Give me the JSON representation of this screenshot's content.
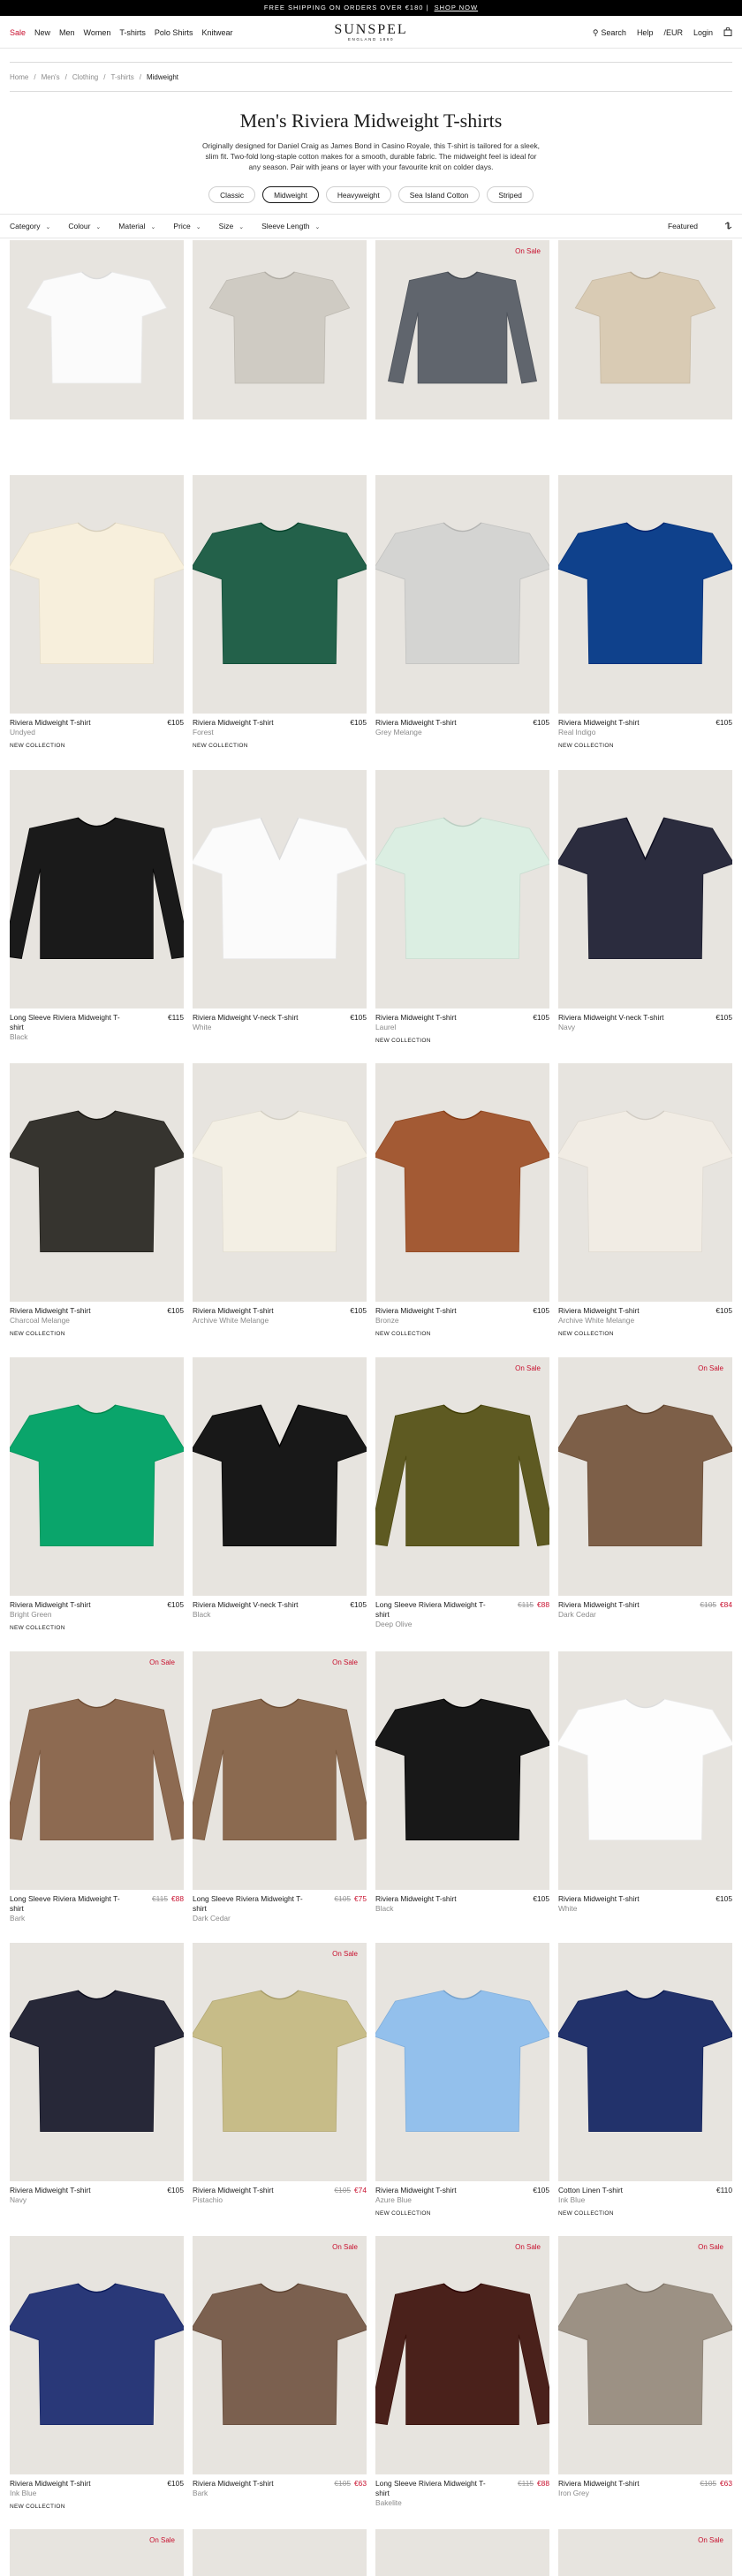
{
  "promo": {
    "text": "FREE SHIPPING ON ORDERS OVER €180",
    "link": "SHOP NOW"
  },
  "nav": {
    "left": [
      "Sale",
      "New",
      "Men",
      "Women",
      "T-shirts",
      "Polo Shirts",
      "Knitwear"
    ],
    "logo": "SUNSPEL",
    "logo_sub": "ENGLAND 1860",
    "search": "Search",
    "help": "Help",
    "currency": "/EUR",
    "login": "Login"
  },
  "breadcrumb": [
    "Home",
    "Men's",
    "Clothing",
    "T-shirts",
    "Midweight"
  ],
  "hero": {
    "title": "Men's Riviera Midweight T-shirts",
    "description": "Originally designed for Daniel Craig as James Bond in Casino Royale, this T-shirt is tailored for a sleek, slim fit. Two-fold long-staple cotton makes for a smooth, durable fabric. The midweight feel is ideal for any season. Pair with jeans or layer with your favourite knit on colder days."
  },
  "chips": [
    "Classic",
    "Midweight",
    "Heavyweight",
    "Sea Island Cotton",
    "Striped"
  ],
  "chips_active": "Midweight",
  "filters": [
    "Category",
    "Colour",
    "Material",
    "Price",
    "Size",
    "Sleeve Length"
  ],
  "sort": {
    "label": "Featured",
    "view_icon": "grid-view-icon"
  },
  "colors": {
    "sale": "#c8102e",
    "image_bg": "#e7e4df"
  },
  "products": [
    {
      "name": "",
      "color": "",
      "price": "",
      "orig_price": "",
      "badge": "",
      "tag": "",
      "shirt_color": "#fbfbfb",
      "type": "tee"
    },
    {
      "name": "",
      "color": "",
      "price": "",
      "orig_price": "",
      "badge": "",
      "tag": "",
      "shirt_color": "#cfcbc3",
      "type": "tee"
    },
    {
      "name": "",
      "color": "",
      "price": "",
      "orig_price": "",
      "badge": "On Sale",
      "tag": "",
      "shirt_color": "#60656d",
      "type": "long"
    },
    {
      "name": "",
      "color": "",
      "price": "",
      "orig_price": "",
      "badge": "",
      "tag": "",
      "shirt_color": "#d9cbb4",
      "type": "tee"
    },
    {
      "name": "Riviera Midweight T-shirt",
      "color": "Undyed",
      "price": "€105",
      "orig_price": "",
      "badge": "",
      "tag": "NEW COLLECTION",
      "shirt_color": "#f7efdc",
      "type": "tee"
    },
    {
      "name": "Riviera Midweight T-shirt",
      "color": "Forest",
      "price": "€105",
      "orig_price": "",
      "badge": "",
      "tag": "NEW COLLECTION",
      "shirt_color": "#23614a",
      "type": "tee"
    },
    {
      "name": "Riviera Midweight T-shirt",
      "color": "Grey Melange",
      "price": "€105",
      "orig_price": "",
      "badge": "",
      "tag": "",
      "shirt_color": "#d4d4d2",
      "type": "tee"
    },
    {
      "name": "Riviera Midweight T-shirt",
      "color": "Real Indigo",
      "price": "€105",
      "orig_price": "",
      "badge": "",
      "tag": "NEW COLLECTION",
      "shirt_color": "#0f418c",
      "type": "tee"
    },
    {
      "name": "Long Sleeve Riviera Midweight T-shirt",
      "color": "Black",
      "price": "€115",
      "orig_price": "",
      "badge": "",
      "tag": "",
      "shirt_color": "#1a1a1a",
      "type": "long"
    },
    {
      "name": "Riviera Midweight V-neck T-shirt",
      "color": "White",
      "price": "€105",
      "orig_price": "",
      "badge": "",
      "tag": "",
      "shirt_color": "#fbfbfb",
      "type": "vneck"
    },
    {
      "name": "Riviera Midweight T-shirt",
      "color": "Laurel",
      "price": "€105",
      "orig_price": "",
      "badge": "",
      "tag": "NEW COLLECTION",
      "shirt_color": "#dbeee2",
      "type": "tee"
    },
    {
      "name": "Riviera Midweight V-neck T-shirt",
      "color": "Navy",
      "price": "€105",
      "orig_price": "",
      "badge": "",
      "tag": "",
      "shirt_color": "#2b2c3e",
      "type": "vneck"
    },
    {
      "name": "Riviera Midweight T-shirt",
      "color": "Charcoal Melange",
      "price": "€105",
      "orig_price": "",
      "badge": "",
      "tag": "NEW COLLECTION",
      "shirt_color": "#36342f",
      "type": "tee"
    },
    {
      "name": "Riviera Midweight T-shirt",
      "color": "Archive White Melange",
      "price": "€105",
      "orig_price": "",
      "badge": "",
      "tag": "",
      "shirt_color": "#f3efe4",
      "type": "tee"
    },
    {
      "name": "Riviera Midweight T-shirt",
      "color": "Bronze",
      "price": "€105",
      "orig_price": "",
      "badge": "",
      "tag": "NEW COLLECTION",
      "shirt_color": "#a35a34",
      "type": "tee"
    },
    {
      "name": "Riviera Midweight T-shirt",
      "color": "Archive White Melange",
      "price": "€105",
      "orig_price": "",
      "badge": "",
      "tag": "NEW COLLECTION",
      "shirt_color": "#f1ece4",
      "type": "tee"
    },
    {
      "name": "Riviera Midweight T-shirt",
      "color": "Bright Green",
      "price": "€105",
      "orig_price": "",
      "badge": "",
      "tag": "NEW COLLECTION",
      "shirt_color": "#0aa56b",
      "type": "tee"
    },
    {
      "name": "Riviera Midweight V-neck T-shirt",
      "color": "Black",
      "price": "€105",
      "orig_price": "",
      "badge": "",
      "tag": "",
      "shirt_color": "#181818",
      "type": "vneck"
    },
    {
      "name": "Long Sleeve Riviera Midweight T-shirt",
      "color": "Deep Olive",
      "price": "€88",
      "orig_price": "€115",
      "badge": "On Sale",
      "tag": "",
      "shirt_color": "#5e5a22",
      "type": "long"
    },
    {
      "name": "Riviera Midweight T-shirt",
      "color": "Dark Cedar",
      "price": "€84",
      "orig_price": "€105",
      "badge": "On Sale",
      "tag": "",
      "shirt_color": "#7d5f48",
      "type": "tee"
    },
    {
      "name": "Long Sleeve Riviera Midweight T-shirt",
      "color": "Bark",
      "price": "€88",
      "orig_price": "€115",
      "badge": "On Sale",
      "tag": "",
      "shirt_color": "#8d6a51",
      "type": "long"
    },
    {
      "name": "Long Sleeve Riviera Midweight T-shirt",
      "color": "Dark Cedar",
      "price": "€75",
      "orig_price": "€105",
      "badge": "On Sale",
      "tag": "",
      "shirt_color": "#8b6a50",
      "type": "long"
    },
    {
      "name": "Riviera Midweight T-shirt",
      "color": "Black",
      "price": "€105",
      "orig_price": "",
      "badge": "",
      "tag": "",
      "shirt_color": "#181818",
      "type": "tee"
    },
    {
      "name": "Riviera Midweight T-shirt",
      "color": "White",
      "price": "€105",
      "orig_price": "",
      "badge": "",
      "tag": "",
      "shirt_color": "#fdfdfd",
      "type": "tee"
    },
    {
      "name": "Riviera Midweight T-shirt",
      "color": "Navy",
      "price": "€105",
      "orig_price": "",
      "badge": "",
      "tag": "",
      "shirt_color": "#272838",
      "type": "tee"
    },
    {
      "name": "Riviera Midweight T-shirt",
      "color": "Pistachio",
      "price": "€74",
      "orig_price": "€105",
      "badge": "On Sale",
      "tag": "",
      "shirt_color": "#c7bc88",
      "type": "tee"
    },
    {
      "name": "Riviera Midweight T-shirt",
      "color": "Azure Blue",
      "price": "€105",
      "orig_price": "",
      "badge": "",
      "tag": "NEW COLLECTION",
      "shirt_color": "#93c0ec",
      "type": "tee"
    },
    {
      "name": "Cotton Linen T-shirt",
      "color": "Ink Blue",
      "price": "€110",
      "orig_price": "",
      "badge": "",
      "tag": "NEW COLLECTION",
      "shirt_color": "#22326b",
      "type": "tee"
    },
    {
      "name": "Riviera Midweight T-shirt",
      "color": "Ink Blue",
      "price": "€105",
      "orig_price": "",
      "badge": "",
      "tag": "NEW COLLECTION",
      "shirt_color": "#293878",
      "type": "tee"
    },
    {
      "name": "Riviera Midweight T-shirt",
      "color": "Bark",
      "price": "€63",
      "orig_price": "€105",
      "badge": "On Sale",
      "tag": "",
      "shirt_color": "#7b604f",
      "type": "tee"
    },
    {
      "name": "Long Sleeve Riviera Midweight T-shirt",
      "color": "Bakelite",
      "price": "€88",
      "orig_price": "€115",
      "badge": "On Sale",
      "tag": "",
      "shirt_color": "#4a211b",
      "type": "long"
    },
    {
      "name": "Riviera Midweight T-shirt",
      "color": "Iron Grey",
      "price": "€63",
      "orig_price": "€105",
      "badge": "On Sale",
      "tag": "",
      "shirt_color": "#9c9184",
      "type": "tee"
    },
    {
      "name": "",
      "color": "",
      "price": "",
      "orig_price": "",
      "badge": "On Sale",
      "tag": "",
      "shirt_color": "",
      "type": "none"
    },
    {
      "name": "",
      "color": "",
      "price": "",
      "orig_price": "",
      "badge": "",
      "tag": "",
      "shirt_color": "",
      "type": "none"
    },
    {
      "name": "",
      "color": "",
      "price": "",
      "orig_price": "",
      "badge": "",
      "tag": "",
      "shirt_color": "",
      "type": "none"
    },
    {
      "name": "",
      "color": "",
      "price": "",
      "orig_price": "",
      "badge": "On Sale",
      "tag": "",
      "shirt_color": "",
      "type": "none"
    }
  ]
}
